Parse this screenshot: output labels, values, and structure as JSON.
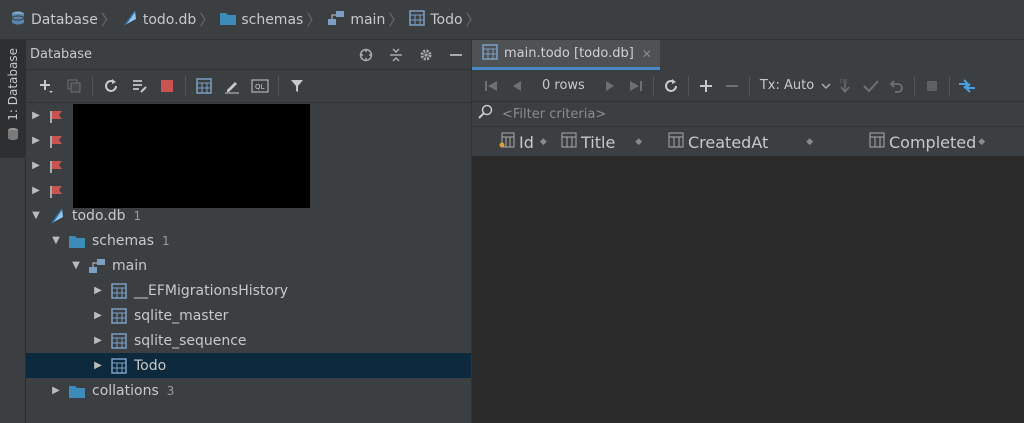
{
  "breadcrumb": [
    "Database",
    "todo.db",
    "schemas",
    "main",
    "Todo"
  ],
  "side_strip": {
    "tab_label": "1: Database"
  },
  "db_panel": {
    "title": "Database",
    "header_icons": [
      "target-icon",
      "collapse-icon",
      "gear-icon",
      "minimize-icon"
    ],
    "toolbar": [
      "add-icon",
      "duplicate-icon",
      "refresh-icon",
      "properties-icon",
      "stop-icon",
      "table-icon",
      "edit-icon",
      "console-icon",
      "filter-icon"
    ]
  },
  "tree": {
    "todo_db": {
      "label": "todo.db",
      "count": "1"
    },
    "schemas": {
      "label": "schemas",
      "count": "1"
    },
    "main": {
      "label": "main"
    },
    "tables": [
      "__EFMigrationsHistory",
      "sqlite_master",
      "sqlite_sequence",
      "Todo"
    ],
    "collations": {
      "label": "collations",
      "count": "3"
    }
  },
  "editor": {
    "tab_label": "main.todo [todo.db]",
    "rows_label": "0 rows",
    "tx_label": "Tx: Auto",
    "filter_placeholder": "<Filter criteria>",
    "columns": [
      "Id",
      "Title",
      "CreatedAt",
      "Completed"
    ]
  },
  "colors": {
    "accent": "#4a88c7",
    "selection": "#0d293e",
    "table_icon": "#7c9fc2",
    "folder": "#3d8bb8"
  }
}
